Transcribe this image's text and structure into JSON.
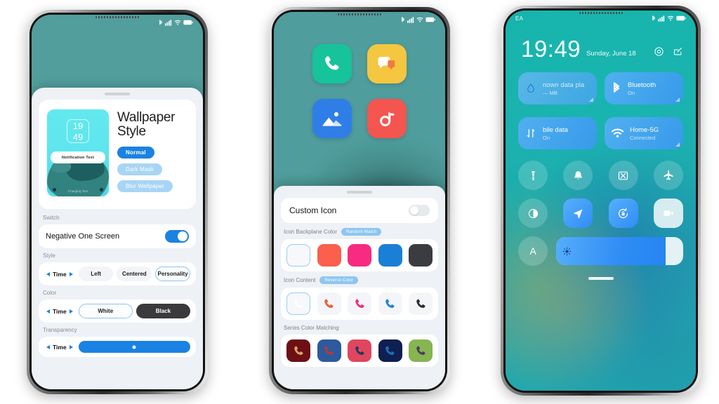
{
  "phone1": {
    "statusbar": {
      "left": "",
      "icons": [
        "bluetooth-icon",
        "signal-icon",
        "wifi-icon",
        "battery-icon"
      ]
    },
    "sheet": {
      "hero": {
        "title_line1": "Wallpaper",
        "title_line2": "Style",
        "preview": {
          "clock_hour": "19",
          "clock_minute": "49",
          "notification_text": "Notification Text",
          "charging_text": "Charging Text"
        },
        "pills": [
          {
            "label": "Normal",
            "state": "active"
          },
          {
            "label": "Dark Mask",
            "state": "dim"
          },
          {
            "label": "Blur Wallpaper",
            "state": "dim"
          }
        ]
      },
      "sections": [
        {
          "label": "Switch",
          "type": "toggle",
          "row_label": "Negative One Screen",
          "toggle_on": true
        },
        {
          "label": "Style",
          "type": "chips",
          "time_label": "Time",
          "chips": [
            {
              "label": "Left",
              "state": "plain"
            },
            {
              "label": "Centered",
              "state": "plain"
            },
            {
              "label": "Personality",
              "state": "outlined"
            }
          ]
        },
        {
          "label": "Color",
          "type": "chips",
          "time_label": "Time",
          "chips": [
            {
              "label": "White",
              "state": "outlined"
            },
            {
              "label": "Black",
              "state": "dark"
            }
          ]
        },
        {
          "label": "Transparency",
          "type": "slider",
          "time_label": "Time",
          "slider_value": 50
        }
      ]
    }
  },
  "phone2": {
    "statusbar": {
      "left": "",
      "icons": [
        "bluetooth-icon",
        "signal-icon",
        "wifi-icon",
        "battery-icon"
      ]
    },
    "apps": [
      {
        "name": "phone-app-icon",
        "label": "Phone",
        "bg": "#17c39a"
      },
      {
        "name": "messages-app-icon",
        "label": "Messages",
        "bg": "#f5c63f"
      },
      {
        "name": "gallery-app-icon",
        "label": "Gallery",
        "bg": "#2f7ee8"
      },
      {
        "name": "music-app-icon",
        "label": "Music",
        "bg": "#f5554f"
      }
    ],
    "sheet": {
      "custom_icon": {
        "title": "Custom Icon",
        "toggle_on": false
      },
      "groups": [
        {
          "label": "Icon Backplane Color",
          "tag": "Random Match",
          "swatches": [
            "#f6f8fb",
            "#fb5f4e",
            "#f72b7f",
            "#1c7fd6",
            "#3a3c41"
          ]
        },
        {
          "label": "Icon Content",
          "tag": "Reverse Color",
          "swatches": [
            "#ffffff",
            "#f05a3c",
            "#f42a78",
            "#1e82d6",
            "#2b2b2d"
          ],
          "icon": "phone-handset-icon"
        },
        {
          "label": "Series Color Matching",
          "tag": "",
          "pairs": [
            {
              "bg": "#6e0f15",
              "fg": "#d9a866"
            },
            {
              "bg": "#2d5a9e",
              "fg": "#c0352f"
            },
            {
              "bg": "#e0465e",
              "fg": "#1d3a63"
            },
            {
              "bg": "#0f1f52",
              "fg": "#1f6fb5"
            },
            {
              "bg": "#86b552",
              "fg": "#4a3a62"
            }
          ],
          "icon": "phone-handset-icon"
        }
      ]
    }
  },
  "phone3": {
    "statusbar": {
      "carrier": "EA",
      "icons": [
        "bluetooth-icon",
        "signal-icon",
        "wifi-icon",
        "battery-icon"
      ]
    },
    "clock": {
      "time": "19:49",
      "date": "Sunday, June 18"
    },
    "actions": [
      "settings-gear-icon",
      "edit-pencil-icon"
    ],
    "big_tiles": [
      {
        "name": "data-usage-tile",
        "icon": "data-drop-icon",
        "title": "nown data pla",
        "sub": "— MB",
        "active": false
      },
      {
        "name": "bluetooth-tile",
        "icon": "bluetooth-icon",
        "title": "Bluetooth",
        "sub": "On",
        "active": true
      }
    ],
    "big_tiles_row2": [
      {
        "name": "mobile-data-tile",
        "icon": "mobile-data-icon",
        "title": "bile data",
        "sub": "On",
        "active": true
      },
      {
        "name": "wifi-tile",
        "icon": "wifi-icon",
        "title": "Home-5G",
        "sub": "Connected",
        "active": true
      }
    ],
    "toggle_circles": [
      {
        "name": "flashlight-toggle",
        "icon": "flashlight-icon",
        "on": false
      },
      {
        "name": "ringer-toggle",
        "icon": "bell-icon",
        "on": false
      },
      {
        "name": "screenshot-toggle",
        "icon": "screenshot-icon",
        "on": false
      },
      {
        "name": "airplane-toggle",
        "icon": "airplane-icon",
        "on": false
      }
    ],
    "toggle_row2": [
      {
        "name": "dark-mode-toggle",
        "icon": "contrast-icon",
        "style": "dim"
      },
      {
        "name": "location-toggle",
        "icon": "location-arrow-icon",
        "style": "on"
      },
      {
        "name": "rotation-lock-toggle",
        "icon": "rotate-lock-icon",
        "style": "on"
      },
      {
        "name": "screen-record-toggle",
        "icon": "video-camera-icon",
        "style": "white"
      }
    ],
    "brightness": {
      "auto_label": "A",
      "value": 86,
      "icon": "sun-icon"
    },
    "home_indicator": true
  }
}
